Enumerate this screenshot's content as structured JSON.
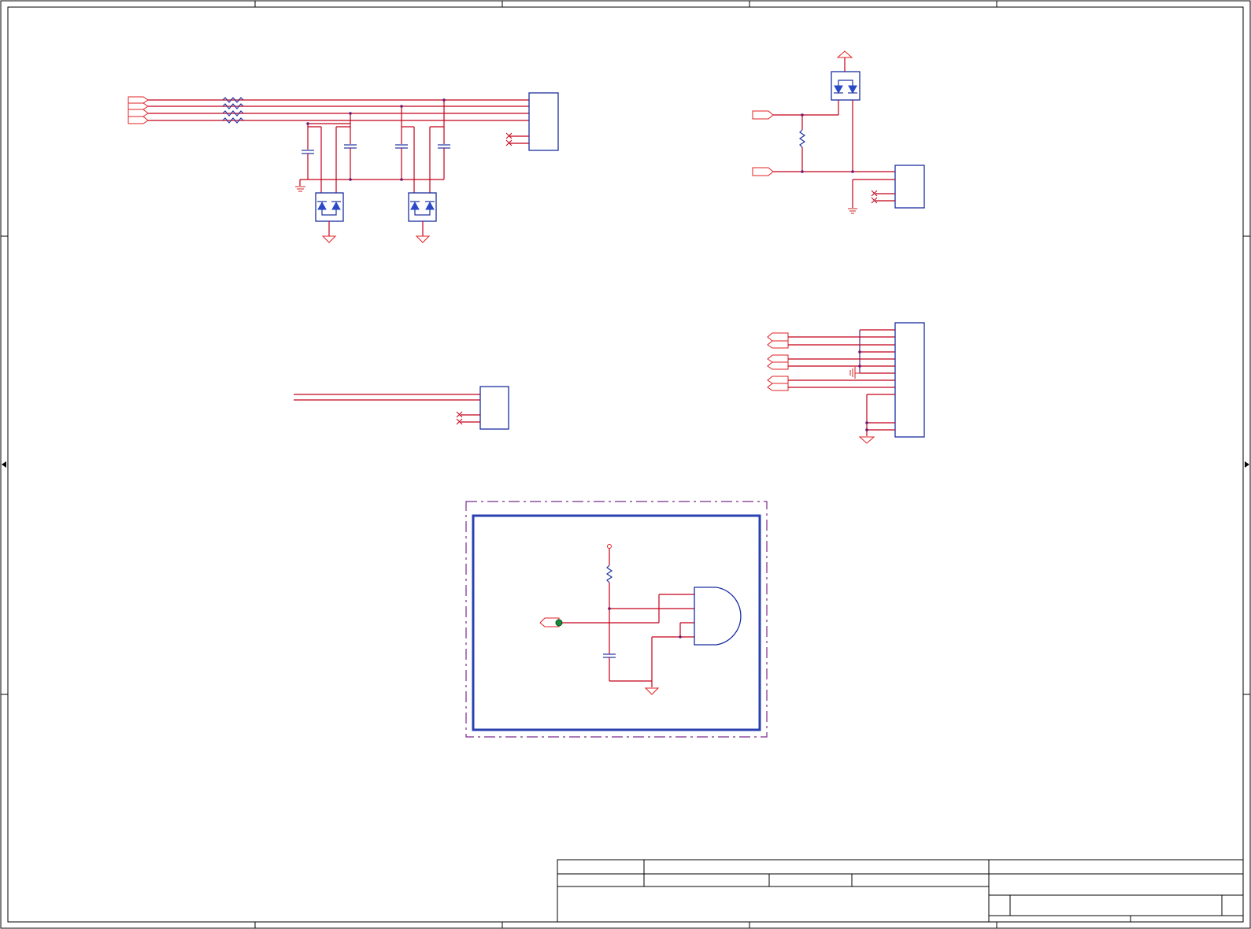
{
  "sheet": {
    "width": 1589,
    "height": 1180
  },
  "colors": {
    "frame": "#000000",
    "wire": "#c4001a",
    "component": "#1a2ea0",
    "port": "#e02020",
    "dash_border": "#7a2a8a",
    "probe_marker": "#1a8a3a"
  },
  "blocks": [
    {
      "id": "usb-connector-block",
      "description": ""
    },
    {
      "id": "power-diode-block",
      "description": ""
    },
    {
      "id": "two-wire-connector-block",
      "description": ""
    },
    {
      "id": "multi-pin-connector-block",
      "description": ""
    },
    {
      "id": "and-gate-reset-block",
      "description": ""
    }
  ],
  "title_block": {
    "cells": []
  }
}
